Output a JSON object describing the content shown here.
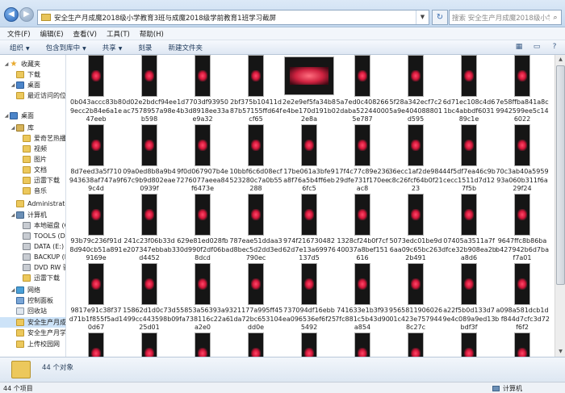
{
  "window": {
    "address": "安全生产月成魔2018级小学教育3班与成魔2018级学前教育1班学习截屏",
    "search_placeholder": "搜索 安全生产月成魔2018级小学教...",
    "icons": {
      "back": "back-arrow-icon",
      "forward": "forward-arrow-icon",
      "refresh": "refresh-icon",
      "search": "search-icon"
    }
  },
  "menu": [
    "文件(F)",
    "编辑(E)",
    "查看(V)",
    "工具(T)",
    "帮助(H)"
  ],
  "toolbar": [
    "组织",
    "包含到库中",
    "共享",
    "刻录",
    "新建文件夹"
  ],
  "sidebar": [
    {
      "label": "收藏夹",
      "icon": "star",
      "level": 0
    },
    {
      "label": "下载",
      "icon": "fold",
      "level": 1
    },
    {
      "label": "桌面",
      "icon": "blue",
      "level": 1
    },
    {
      "label": "最近访问的位置",
      "icon": "fold",
      "level": 1
    },
    {
      "label": "",
      "icon": "",
      "level": -1
    },
    {
      "label": "桌面",
      "icon": "blue",
      "level": 0
    },
    {
      "label": "库",
      "icon": "lib",
      "level": 1
    },
    {
      "label": "爱奇艺热播视",
      "icon": "fold",
      "level": 2
    },
    {
      "label": "视频",
      "icon": "fold",
      "level": 2
    },
    {
      "label": "图片",
      "icon": "fold",
      "level": 2
    },
    {
      "label": "文档",
      "icon": "fold",
      "level": 2
    },
    {
      "label": "迅雷下载",
      "icon": "fold",
      "level": 2
    },
    {
      "label": "音乐",
      "icon": "fold",
      "level": 2
    },
    {
      "label": "Administrator",
      "icon": "fold",
      "level": 1
    },
    {
      "label": "计算机",
      "icon": "pc",
      "level": 1
    },
    {
      "label": "本地磁盘 (C:",
      "icon": "drive",
      "level": 2
    },
    {
      "label": "TOOLS (D:)",
      "icon": "drive",
      "level": 2
    },
    {
      "label": "DATA (E:)",
      "icon": "drive",
      "level": 2
    },
    {
      "label": "BACKUP (F:",
      "icon": "drive",
      "level": 2
    },
    {
      "label": "DVD RW 驱",
      "icon": "drive",
      "level": 2
    },
    {
      "label": "迅雷下载",
      "icon": "fold",
      "level": 2
    },
    {
      "label": "网络",
      "icon": "net",
      "level": 1
    },
    {
      "label": "控制面板",
      "icon": "ctrl",
      "level": 1
    },
    {
      "label": "回收站",
      "icon": "bin",
      "level": 1
    },
    {
      "label": "安全生产月成",
      "icon": "fold",
      "level": 1,
      "selected": true
    },
    {
      "label": "安全生产月学",
      "icon": "fold",
      "level": 1
    },
    {
      "label": "上传校园网",
      "icon": "fold",
      "level": 1
    }
  ],
  "files": [
    "0b043accc83b89ecc2b84e6a1e47eeb",
    "0d02e2bdcf94eeac7578957a98eb598",
    "1d7703df939504b3d8918ee33ae9a32",
    "2bf375b10411d87b57155ffd64fcf65",
    "2e2e9ef5fa34b8e4be170d191b02e8a",
    "5a7ed0c408266 2daba522440005e787",
    "5f28a342ecf7c25a9e404088801d595",
    "6d71ec108c4d61bc4abbdf603189c1e",
    "7e58ffba841a8c9942599ee5c146022",
    "8d7eed3a5f710943638af747a9f9c4d",
    "09a0ed8b8a9b467c9b9d802eae0939f",
    "9f0d067907b4e7276077aeea84f6473e",
    "10bbf6c6d08ecf523280c7a0b55288",
    "17be061a3bfe9a8f76a5b4ff6eb6fc5",
    "17f4c77c89e23629dfe731f170eeac8",
    "36ecc1af2de984c8c26fcf64b0f2123",
    "44f5df7ea46c9bcecc1511d7d127f5b",
    "70c3ab40a595993a060b311f6a29f24",
    "93b79c236f91d8d940cb51a8919169e",
    "241c23f06b33de207347ebbab3d4452",
    "629e81ed028fb30d990f2df06ba8dcd",
    "787eae51ddaa3d8bec5d2dd3ed790ec",
    "974f21673048262d7e13a69976137d5",
    "1328cf24b0f7cf40037a8bef151616",
    "5073edc01be9d6aa09c65bc2632b491",
    "07405a3511a7fdfce32b908ea2ba8d6",
    "9647ffc8b86ba b427942b6d7baf7a01",
    "9817e91c38f37d71b1f855f5ad10d67",
    "15862d1d0c73d499cc443598b025d01",
    "55853a56393a99fa738116c22a6a2e0",
    "321177a995ff451da72bc653104dd0e",
    "737094df16ebbea096536ef6f255492",
    "741633e1b3f937fc881c5b43d90a854",
    "956581190602601c423e7579448c27c",
    "a22f5b0d133d79e4c089a9ed13bdf3f",
    "a098a581dcb1db f844d7cfc3d72f6f2",
    "",
    "",
    "",
    "",
    "",
    "",
    "",
    "",
    ""
  ],
  "status": {
    "count_big": "44 个对象",
    "count_small": "44 个项目",
    "location": "计算机"
  }
}
